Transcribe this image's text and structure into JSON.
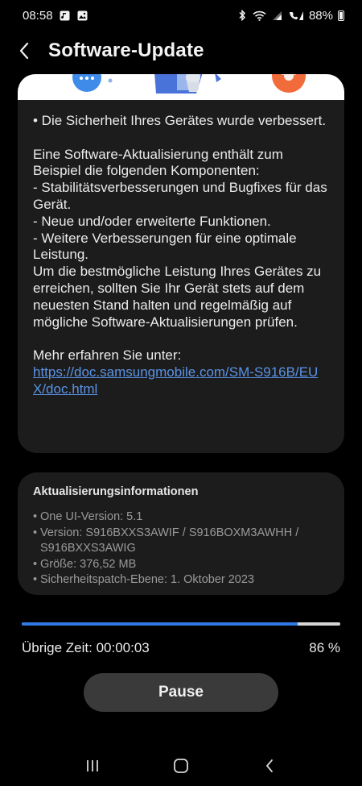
{
  "status_bar": {
    "time": "08:58",
    "battery": "88%",
    "icons": [
      "media-icon",
      "gallery-icon",
      "bluetooth-icon",
      "wifi-icon",
      "signal-icon",
      "signal-icon",
      "battery-icon"
    ]
  },
  "header": {
    "title": "Software-Update",
    "back_icon": "chevron-left-icon"
  },
  "notes": {
    "security_line": "• Die Sicherheit Ihres Gerätes wurde verbessert.",
    "body": "Eine Software-Aktualisierung enthält zum Beispiel die folgenden Komponenten:\n - Stabilitätsverbesserungen und Bugfixes für das Gerät.\n - Neue und/oder erweiterte Funktionen.\n - Weitere Verbesserungen für eine optimale Leistung.\nUm die bestmögliche Leistung Ihres Gerätes zu erreichen, sollten Sie Ihr Gerät stets auf dem neuesten Stand halten und regelmäßig auf mögliche Software-Aktualisierungen prüfen.",
    "more_info": "Mehr erfahren Sie unter:",
    "link": "https://doc.samsungmobile.com/SM-S916B/EUX/doc.html"
  },
  "info": {
    "title": "Aktualisierungsinformationen",
    "items": [
      "One UI-Version: 5.1",
      "Version: S916BXXS3AWIF / S916BOXM3AWHH / S916BXXS3AWIG",
      "Größe: 376,52 MB",
      "Sicherheitspatch-Ebene: 1. Oktober 2023"
    ]
  },
  "progress": {
    "percent_value": 0.865,
    "remaining_time": "Übrige Zeit: 00:00:03",
    "percent_label": "86 %"
  },
  "actions": {
    "pause_label": "Pause"
  },
  "colors": {
    "accent": "#2f7ae5",
    "link": "#5a93e6",
    "card": "#1c1c1c"
  }
}
